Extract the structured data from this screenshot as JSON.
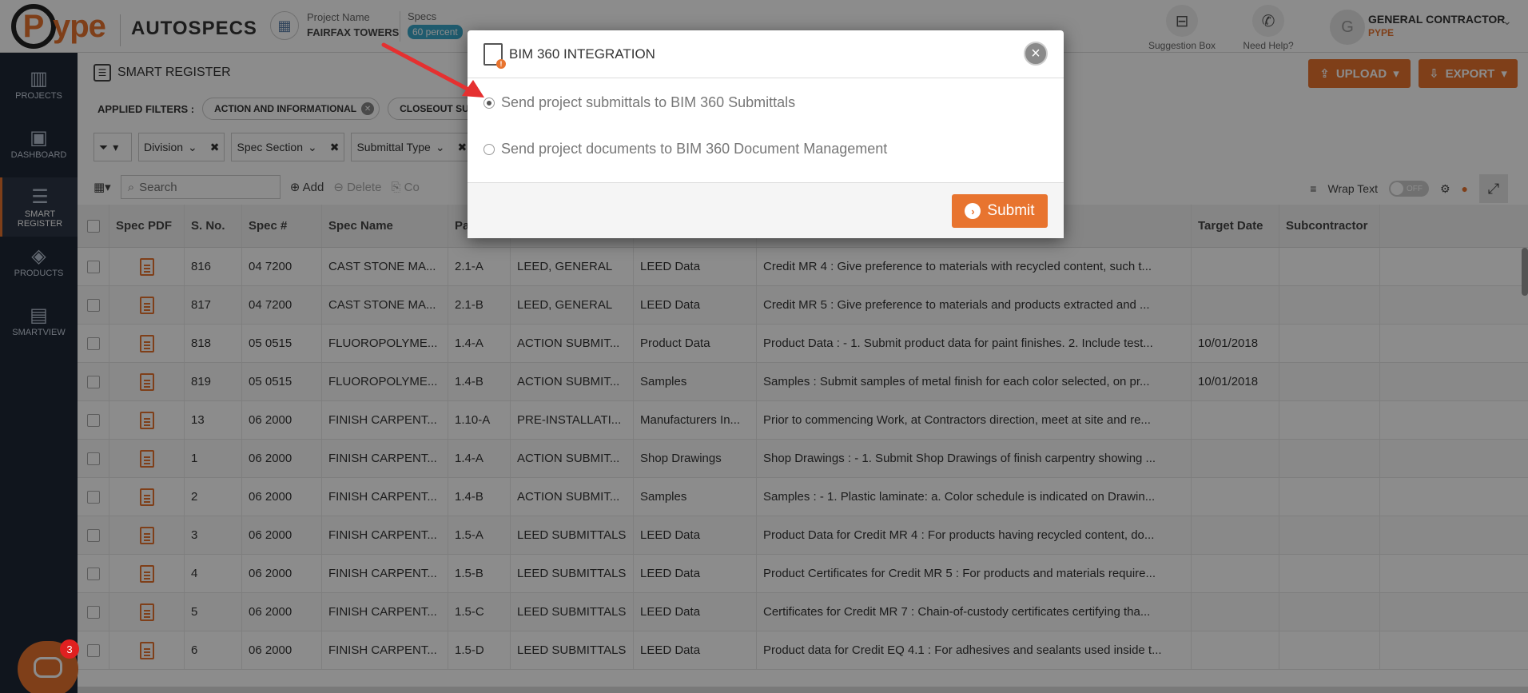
{
  "header": {
    "logo_text": "ype",
    "logo_letter": "P",
    "app_name": "AUTOSPECS",
    "project_label": "Project Name",
    "project_value": "FAIRFAX TOWERS",
    "specs_label": "Specs",
    "specs_badge": "60 percent",
    "suggestion_label": "Suggestion Box",
    "help_label": "Need Help?",
    "user_initial": "G",
    "user_name": "GENERAL CONTRACTOR",
    "user_company": "PYPE"
  },
  "sidebar": {
    "items": [
      {
        "label": "PROJECTS",
        "icon": "building-icon"
      },
      {
        "label": "DASHBOARD",
        "icon": "monitor-icon"
      },
      {
        "label": "SMART REGISTER",
        "icon": "register-icon"
      },
      {
        "label": "PRODUCTS",
        "icon": "tag-icon"
      },
      {
        "label": "SMARTVIEW",
        "icon": "smartview-icon"
      }
    ]
  },
  "main": {
    "title": "SMART REGISTER",
    "upload_label": "UPLOAD",
    "export_label": "EXPORT",
    "applied_filters_label": "APPLIED FILTERS :",
    "chips": [
      "ACTION AND INFORMATIONAL",
      "CLOSEOUT SUBM"
    ],
    "dropdowns": [
      "Division",
      "Spec Section",
      "Submittal Type"
    ],
    "search_placeholder": "Search",
    "add_label": "Add",
    "delete_label": "Delete",
    "copy_label": "Co",
    "wrap_text_label": "Wrap Text",
    "toggle_label": "OFF"
  },
  "table": {
    "columns": [
      "Spec PDF",
      "S. No.",
      "Spec #",
      "Spec Name",
      "Pa",
      "",
      "",
      "",
      "Target Date",
      "Subcontractor"
    ],
    "rows": [
      {
        "sno": "816",
        "spec": "04 7200",
        "name": "CAST STONE MA...",
        "para": "2.1-A",
        "group": "LEED, GENERAL",
        "type": "LEED Data",
        "desc": "Credit MR 4 : Give preference to materials with recycled content, such t...",
        "target": ""
      },
      {
        "sno": "817",
        "spec": "04 7200",
        "name": "CAST STONE MA...",
        "para": "2.1-B",
        "group": "LEED, GENERAL",
        "type": "LEED Data",
        "desc": "Credit MR 5 : Give preference to materials and products extracted and ...",
        "target": ""
      },
      {
        "sno": "818",
        "spec": "05 0515",
        "name": "FLUOROPOLYME...",
        "para": "1.4-A",
        "group": "ACTION SUBMIT...",
        "type": "Product Data",
        "desc": "Product Data : - 1. Submit product data for paint finishes. 2. Include test...",
        "target": "10/01/2018"
      },
      {
        "sno": "819",
        "spec": "05 0515",
        "name": "FLUOROPOLYME...",
        "para": "1.4-B",
        "group": "ACTION SUBMIT...",
        "type": "Samples",
        "desc": "Samples : Submit samples of metal finish for each color selected, on pr...",
        "target": "10/01/2018"
      },
      {
        "sno": "13",
        "spec": "06 2000",
        "name": "FINISH CARPENT...",
        "para": "1.10-A",
        "group": "PRE-INSTALLATI...",
        "type": "Manufacturers In...",
        "desc": "Prior to commencing Work, at Contractors direction, meet at site and re...",
        "target": ""
      },
      {
        "sno": "1",
        "spec": "06 2000",
        "name": "FINISH CARPENT...",
        "para": "1.4-A",
        "group": "ACTION SUBMIT...",
        "type": "Shop Drawings",
        "desc": "Shop Drawings : - 1. Submit Shop Drawings of finish carpentry showing ...",
        "target": ""
      },
      {
        "sno": "2",
        "spec": "06 2000",
        "name": "FINISH CARPENT...",
        "para": "1.4-B",
        "group": "ACTION SUBMIT...",
        "type": "Samples",
        "desc": "Samples : - 1. Plastic laminate: a. Color schedule is indicated on Drawin...",
        "target": ""
      },
      {
        "sno": "3",
        "spec": "06 2000",
        "name": "FINISH CARPENT...",
        "para": "1.5-A",
        "group": "LEED SUBMITTALS",
        "type": "LEED Data",
        "desc": "Product Data for Credit MR 4 : For products having recycled content, do...",
        "target": ""
      },
      {
        "sno": "4",
        "spec": "06 2000",
        "name": "FINISH CARPENT...",
        "para": "1.5-B",
        "group": "LEED SUBMITTALS",
        "type": "LEED Data",
        "desc": "Product Certificates for Credit MR 5 : For products and materials require...",
        "target": ""
      },
      {
        "sno": "5",
        "spec": "06 2000",
        "name": "FINISH CARPENT...",
        "para": "1.5-C",
        "group": "LEED SUBMITTALS",
        "type": "LEED Data",
        "desc": "Certificates for Credit MR 7 : Chain-of-custody certificates certifying tha...",
        "target": ""
      },
      {
        "sno": "6",
        "spec": "06 2000",
        "name": "FINISH CARPENT...",
        "para": "1.5-D",
        "group": "LEED SUBMITTALS",
        "type": "LEED Data",
        "desc": "Product data for Credit EQ 4.1 : For adhesives and sealants used inside t...",
        "target": ""
      }
    ]
  },
  "modal": {
    "title": "BIM 360 INTEGRATION",
    "option1": "Send project submittals to BIM 360 Submittals",
    "option2": "Send project documents to BIM 360 Document Management",
    "selected_option": 1,
    "submit_label": "Submit"
  },
  "chat": {
    "badge_count": "3"
  },
  "colors": {
    "accent": "#e8742f",
    "sidebar": "#1e2735",
    "badge": "#3aa7c9",
    "annotation": "#e53030"
  }
}
